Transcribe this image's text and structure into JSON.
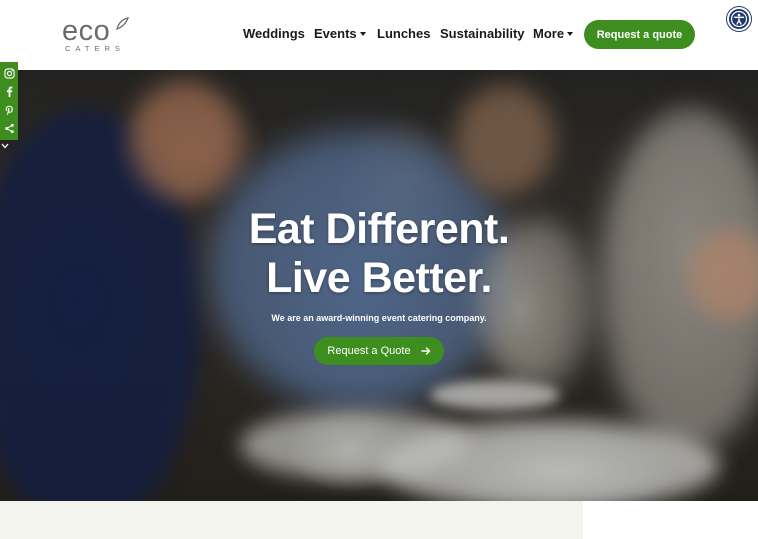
{
  "brand": {
    "logo_word": "eco",
    "logo_sub": "CATERS"
  },
  "nav": {
    "items": [
      {
        "label": "Weddings",
        "has_dropdown": false
      },
      {
        "label": "Events",
        "has_dropdown": true
      },
      {
        "label": "Lunches",
        "has_dropdown": false
      },
      {
        "label": "Sustainability",
        "has_dropdown": false
      },
      {
        "label": "More",
        "has_dropdown": true
      }
    ],
    "cta_label": "Request a quote"
  },
  "accessibility": {
    "icon": "accessibility-icon"
  },
  "social": {
    "items": [
      {
        "icon": "instagram-icon"
      },
      {
        "icon": "facebook-icon"
      },
      {
        "icon": "pinterest-icon"
      },
      {
        "icon": "share-icon"
      }
    ],
    "toggle_icon": "chevron-down-icon"
  },
  "hero": {
    "title_line1": "Eat Different.",
    "title_line2": "Live Better.",
    "subtitle": "We are an award-winning event catering company.",
    "button_label": "Request a Quote",
    "button_icon": "arrow-right-icon"
  },
  "colors": {
    "brand_green": "#3e8e1f",
    "accessibility_blue": "#1f3a6b",
    "nav_text": "#1a1a1a",
    "logo_gray": "#6b6b6b"
  }
}
